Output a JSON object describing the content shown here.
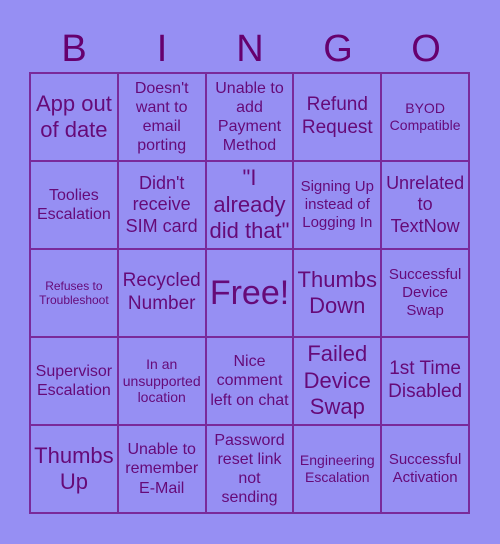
{
  "header": [
    "B",
    "I",
    "N",
    "G",
    "O"
  ],
  "cells": [
    {
      "text": "App out of date",
      "size": 22
    },
    {
      "text": "Doesn't want to email porting",
      "size": 16
    },
    {
      "text": "Unable to add Payment Method",
      "size": 16
    },
    {
      "text": "Refund Request",
      "size": 19
    },
    {
      "text": "BYOD Compatible",
      "size": 14
    },
    {
      "text": "Toolies Escalation",
      "size": 16
    },
    {
      "text": "Didn't receive SIM card",
      "size": 18
    },
    {
      "text": "\"I already did that\"",
      "size": 22
    },
    {
      "text": "Signing Up instead of Logging In",
      "size": 15
    },
    {
      "text": "Unrelated to TextNow",
      "size": 18
    },
    {
      "text": "Refuses to Troubleshoot",
      "size": 12
    },
    {
      "text": "Recycled Number",
      "size": 19
    },
    {
      "text": "Free!",
      "size": 34
    },
    {
      "text": "Thumbs Down",
      "size": 22
    },
    {
      "text": "Successful Device Swap",
      "size": 15
    },
    {
      "text": "Supervisor Escalation",
      "size": 16
    },
    {
      "text": "In an unsupported location",
      "size": 14
    },
    {
      "text": "Nice comment left on chat",
      "size": 16
    },
    {
      "text": "Failed Device Swap",
      "size": 22
    },
    {
      "text": "1st Time Disabled",
      "size": 19
    },
    {
      "text": "Thumbs Up",
      "size": 22
    },
    {
      "text": "Unable to remember E-Mail",
      "size": 16
    },
    {
      "text": "Password reset link not sending",
      "size": 16
    },
    {
      "text": "Engineering Escalation",
      "size": 14
    },
    {
      "text": "Successful Activation",
      "size": 15
    }
  ],
  "colors": {
    "background": "#968ff3",
    "text": "#660a78",
    "border": "#7a2a9a"
  }
}
